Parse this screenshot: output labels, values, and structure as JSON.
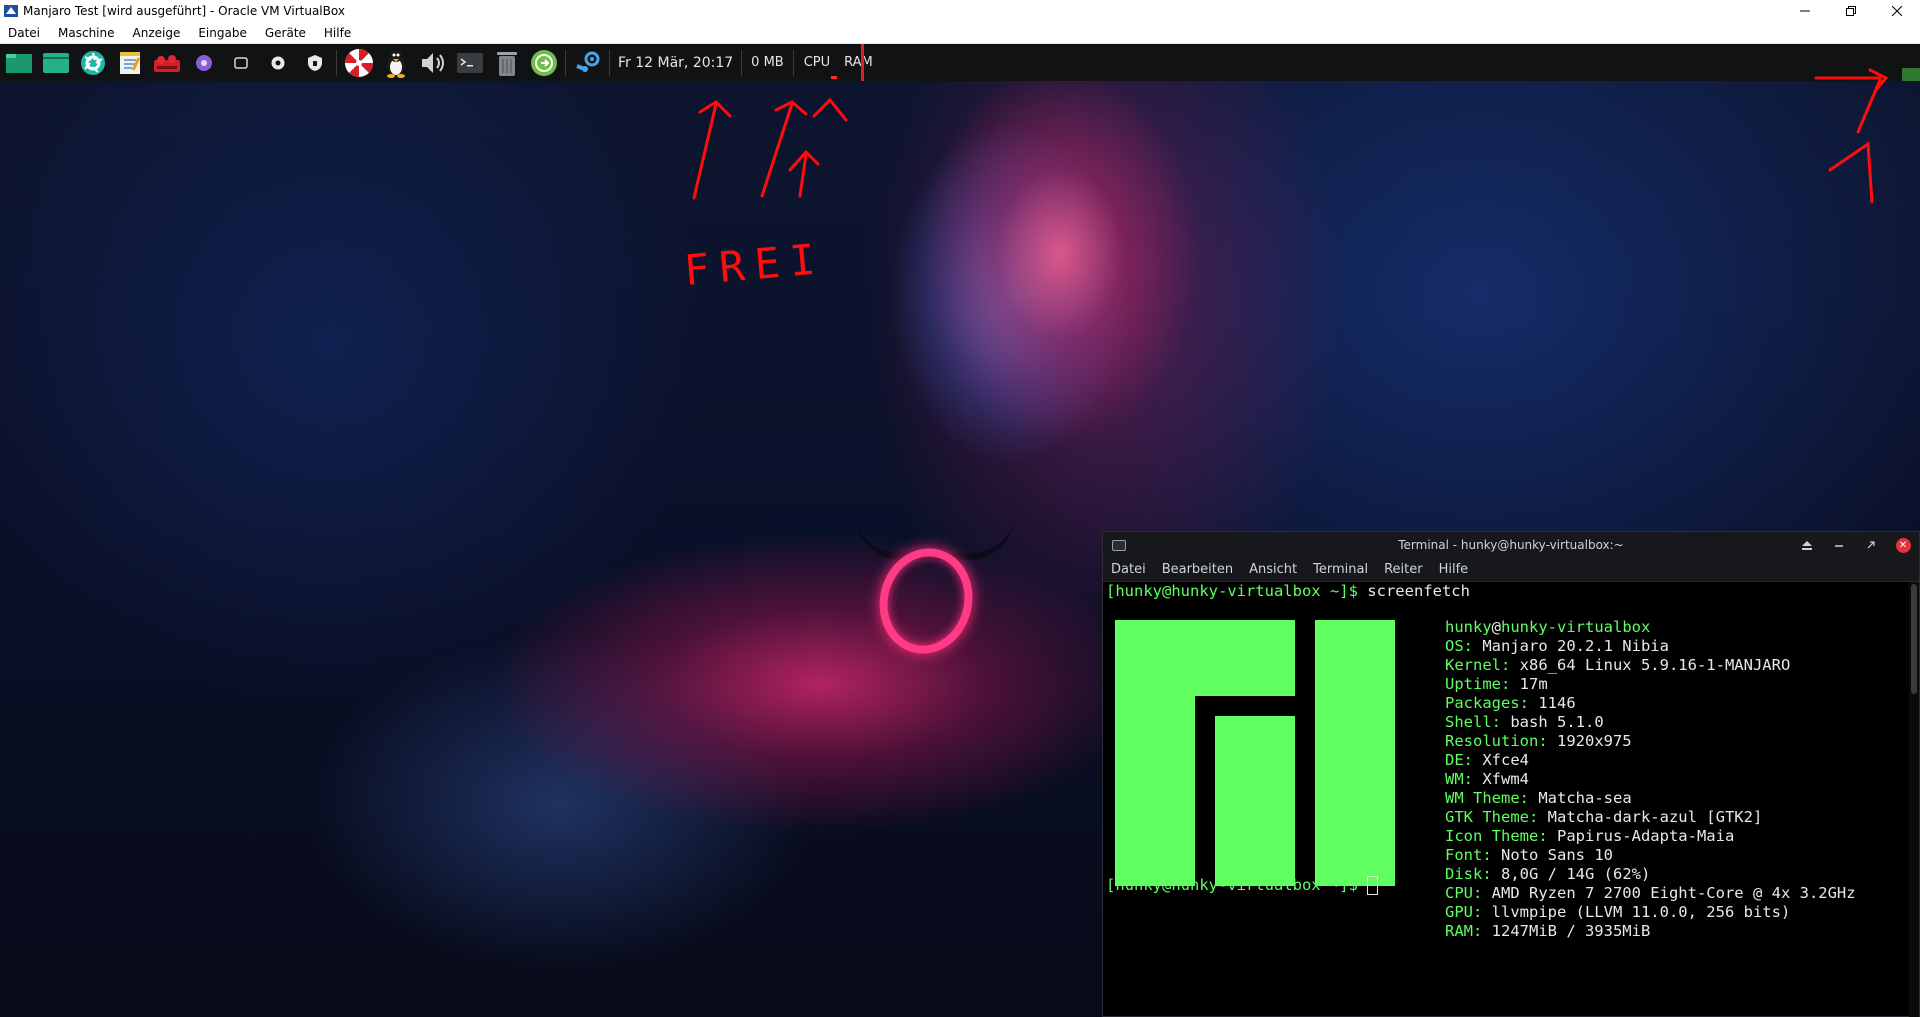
{
  "host": {
    "title": "Manjaro Test [wird ausgeführt] - Oracle VM VirtualBox",
    "menu": [
      "Datei",
      "Maschine",
      "Anzeige",
      "Eingabe",
      "Geräte",
      "Hilfe"
    ]
  },
  "panel": {
    "launchers": [
      "workspace-icon",
      "file-manager-icon",
      "aperture-icon",
      "text-editor-icon",
      "red-app-icon",
      "purple-app-icon",
      "window-icon",
      "circle-icon",
      "shield-icon",
      "umbrella-icon",
      "tux-icon",
      "volume-icon",
      "terminal-icon",
      "trash-icon",
      "update-icon",
      "steam-icon"
    ],
    "clock": "Fr 12 Mär, 20:17",
    "memory": "0 MB",
    "cpu_label": "CPU",
    "ram_label": "RAM"
  },
  "annotation": {
    "text": "FREI",
    "color": "#ff0d0d"
  },
  "terminal": {
    "title": "Terminal - hunky@hunky-virtualbox:~",
    "menu": [
      "Datei",
      "Bearbeiten",
      "Ansicht",
      "Terminal",
      "Reiter",
      "Hilfe"
    ],
    "prompt": "[hunky@hunky-virtualbox ~]$",
    "command": " screenfetch",
    "user": "hunky",
    "at": "@",
    "host": "hunky-virtualbox",
    "info": [
      {
        "key": "OS:",
        "value": " Manjaro 20.2.1 Nibia"
      },
      {
        "key": "Kernel:",
        "value": " x86_64 Linux 5.9.16-1-MANJARO"
      },
      {
        "key": "Uptime:",
        "value": " 17m"
      },
      {
        "key": "Packages:",
        "value": " 1146"
      },
      {
        "key": "Shell:",
        "value": " bash 5.1.0"
      },
      {
        "key": "Resolution:",
        "value": " 1920x975"
      },
      {
        "key": "DE:",
        "value": " Xfce4"
      },
      {
        "key": "WM:",
        "value": " Xfwm4"
      },
      {
        "key": "WM Theme:",
        "value": " Matcha-sea"
      },
      {
        "key": "GTK Theme:",
        "value": " Matcha-dark-azul [GTK2]"
      },
      {
        "key": "Icon Theme:",
        "value": " Papirus-Adapta-Maia"
      },
      {
        "key": "Font:",
        "value": " Noto Sans 10"
      },
      {
        "key": "Disk:",
        "value": " 8,0G / 14G (62%)"
      },
      {
        "key": "CPU:",
        "value": " AMD Ryzen 7 2700 Eight-Core @ 4x 3.2GHz"
      },
      {
        "key": "GPU:",
        "value": " llvmpipe (LLVM 11.0.0, 256 bits)"
      },
      {
        "key": "RAM:",
        "value": " 1247MiB / 3935MiB"
      }
    ],
    "accent": "#5fff5f"
  }
}
